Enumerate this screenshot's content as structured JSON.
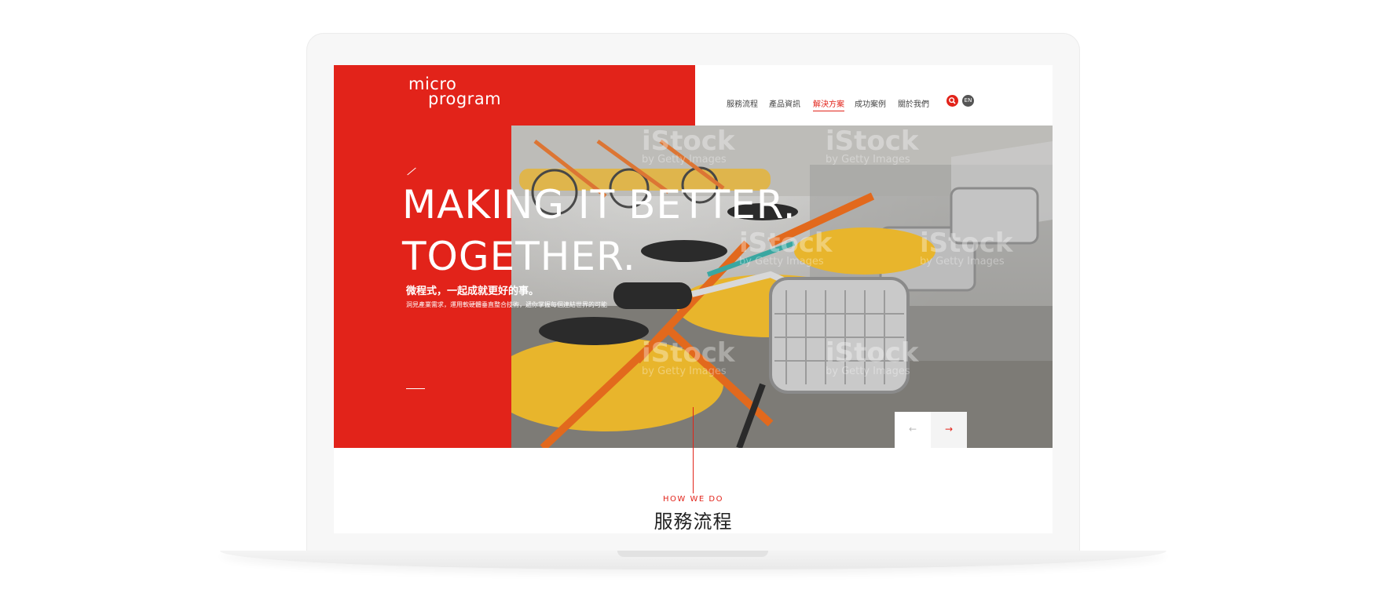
{
  "logo": {
    "line1": "micro",
    "line2": "program"
  },
  "nav": {
    "items": [
      {
        "label": "服務流程"
      },
      {
        "label": "產品資訊"
      },
      {
        "label": "解決方案",
        "active": true
      },
      {
        "label": "成功案例"
      },
      {
        "label": "關於我們"
      }
    ],
    "lang": "EN"
  },
  "hero": {
    "headline_line1": "MAKING IT BETTER.",
    "headline_line2": "TOGETHER.",
    "subtitle": "微程式，一起成就更好的事。",
    "description": "洞見產業需求，運用軟硬體垂直整合技術，遞你掌握每個連結世界的可能",
    "watermark": "iStock",
    "watermark_sub": "by Getty Images"
  },
  "slider": {
    "prev_icon": "arrow-left-icon",
    "next_icon": "arrow-right-icon"
  },
  "section": {
    "eyebrow": "HOW WE DO",
    "title": "服務流程"
  },
  "colors": {
    "accent": "#e2231a",
    "text": "#222222",
    "nav_text": "#444444"
  }
}
